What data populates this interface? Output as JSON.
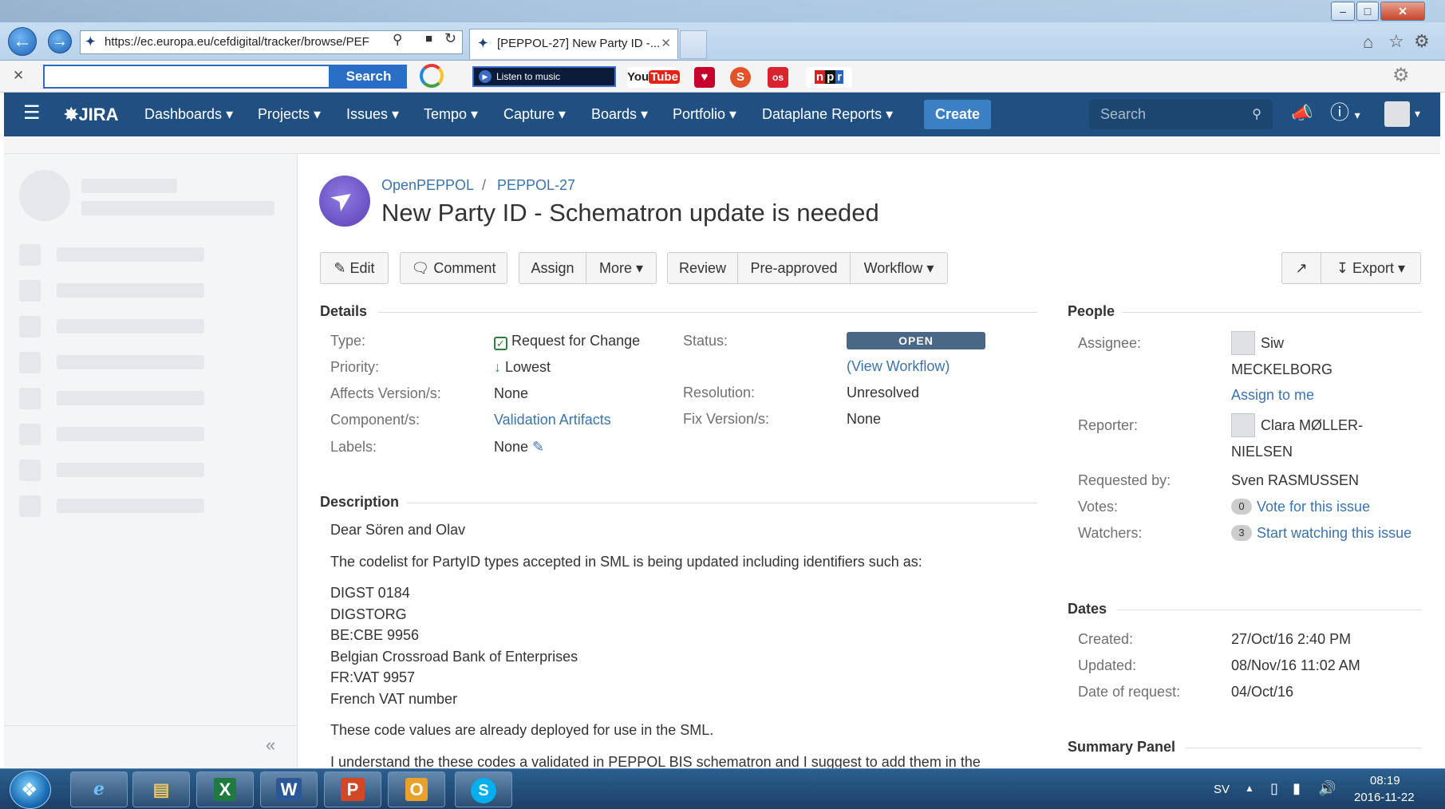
{
  "browser": {
    "url": "https://ec.europa.eu/cefdigital/tracker/browse/PEF",
    "tab_title": "[PEPPOL-27] New Party ID -...",
    "toolbar_search_label": "Search",
    "listen_label": "Listen to music",
    "youtube_label": "YouTube",
    "npr_label": "npr"
  },
  "jira": {
    "logo": "JIRA",
    "nav": [
      "Dashboards",
      "Projects",
      "Issues",
      "Tempo",
      "Capture",
      "Boards",
      "Portfolio",
      "Dataplane Reports"
    ],
    "create_label": "Create",
    "search_placeholder": "Search"
  },
  "issue": {
    "project": "OpenPEPPOL",
    "separator": "/",
    "key": "PEPPOL-27",
    "title": "New Party ID - Schematron update is needed",
    "buttons": {
      "edit": "Edit",
      "comment": "Comment",
      "assign": "Assign",
      "more": "More",
      "review": "Review",
      "pre_approved": "Pre-approved",
      "workflow": "Workflow",
      "export": "Export"
    },
    "details": {
      "heading": "Details",
      "type_label": "Type:",
      "type_value": "Request for Change",
      "priority_label": "Priority:",
      "priority_value": "Lowest",
      "affects_label": "Affects Version/s:",
      "affects_value": "None",
      "component_label": "Component/s:",
      "component_value": "Validation Artifacts",
      "labels_label": "Labels:",
      "labels_value": "None",
      "status_label": "Status:",
      "status_value": "OPEN",
      "view_workflow": "View Workflow",
      "resolution_label": "Resolution:",
      "resolution_value": "Unresolved",
      "fix_label": "Fix Version/s:",
      "fix_value": "None"
    },
    "description": {
      "heading": "Description",
      "greeting": "Dear Sören and Olav",
      "intro": "The codelist for PartyID types accepted in SML is being updated including identifiers such as:",
      "codes": [
        "DIGST 0184",
        "DIGSTORG",
        "BE:CBE 9956",
        "Belgian Crossroad Bank of Enterprises",
        "FR:VAT 9957",
        "French VAT number"
      ],
      "deployed": "These code values are already deployed for use in the SML.",
      "understand": "I understand the these codes a validated in PEPPOL BIS schematron and I suggest to add them in the"
    },
    "people": {
      "heading": "People",
      "assignee_label": "Assignee:",
      "assignee_first": "Siw",
      "assignee_last": "MECKELBORG",
      "assign_to_me": "Assign to me",
      "reporter_label": "Reporter:",
      "reporter_first": "Clara MØLLER-",
      "reporter_last": "NIELSEN",
      "requested_by_label": "Requested by:",
      "requested_by_value": "Sven RASMUSSEN",
      "votes_label": "Votes:",
      "votes_count": "0",
      "vote_link": "Vote for this issue",
      "watchers_label": "Watchers:",
      "watchers_count": "3",
      "watch_link": "Start watching this issue"
    },
    "dates": {
      "heading": "Dates",
      "created_label": "Created:",
      "created_value": "27/Oct/16 2:40 PM",
      "updated_label": "Updated:",
      "updated_value": "08/Nov/16 11:02 AM",
      "request_label": "Date of request:",
      "request_value": "04/Oct/16"
    },
    "summary_heading": "Summary Panel"
  },
  "taskbar": {
    "lang": "SV",
    "time": "08:19",
    "date": "2016-11-22"
  },
  "colors": {
    "jira_header": "#205081",
    "link": "#3b73af",
    "create_button": "#3b7fc4",
    "status_open": "#4a6785"
  }
}
